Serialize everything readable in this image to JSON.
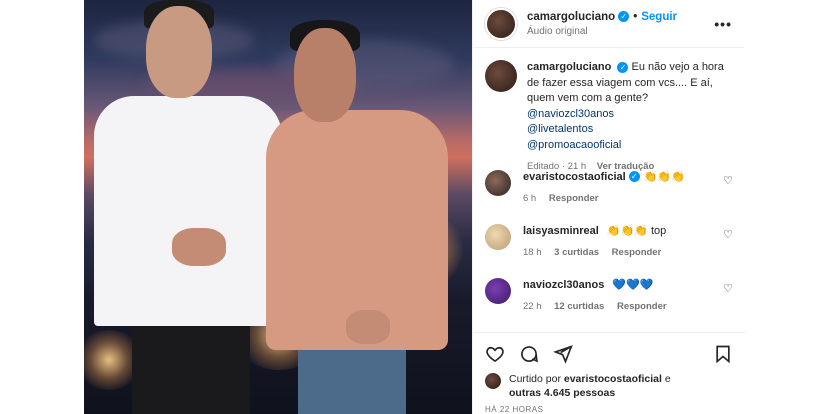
{
  "header": {
    "username": "camargoluciano",
    "dot": "•",
    "follow_label": "Seguir",
    "audio_label": "Áudio original",
    "more_glyph": "•••"
  },
  "caption": {
    "username": "camargoluciano",
    "text": "Eu não vejo a hora de fazer essa viagem com vcs.... E aí, quem vem com a gente?",
    "mentions": [
      "@naviozcl30anos",
      "@livetalentos",
      "@promoacaooficial"
    ],
    "edited": "Editado · 21 h",
    "see_translation": "Ver tradução"
  },
  "comments": [
    {
      "username": "evaristocostaoficial",
      "text": "👏👏👏",
      "time": "6 h",
      "likes": "",
      "reply": "Responder"
    },
    {
      "username": "laisyasminreal",
      "text": "👏👏👏 top",
      "time": "18 h",
      "likes": "3 curtidas",
      "reply": "Responder"
    },
    {
      "username": "naviozcl30anos",
      "text": "💙💙💙",
      "time": "22 h",
      "likes": "12 curtidas",
      "reply": "Responder"
    }
  ],
  "likes": {
    "prefix": "Curtido por",
    "user": "evaristocostaoficial",
    "connector": "e",
    "others": "outras 4.645 pessoas"
  },
  "timestamp": "HÁ 22 HORAS",
  "colors": {
    "accent": "#0095f6",
    "mention": "#00376b",
    "muted": "#737373"
  },
  "icons": [
    "heart-icon",
    "comment-icon",
    "share-icon",
    "bookmark-icon",
    "verified-icon",
    "more-icon"
  ]
}
